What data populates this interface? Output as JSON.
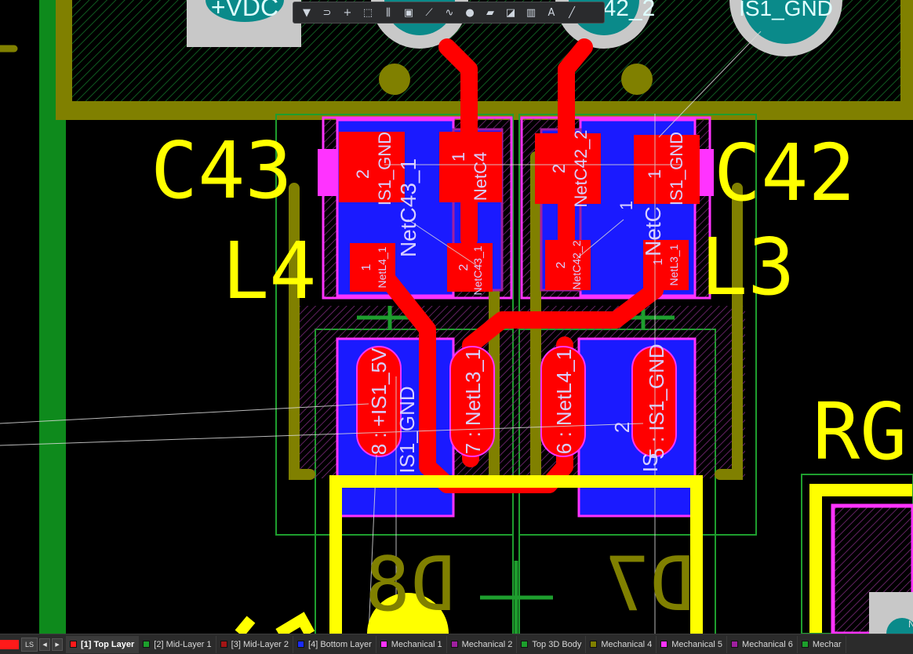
{
  "canvas": {
    "designators": {
      "c43": "C43",
      "c42": "C42",
      "l4": "L4",
      "l3": "L3",
      "rg": "RG",
      "d8": "D8",
      "d7": "D7"
    },
    "pad_labels": {
      "vdc": "+VDC",
      "net42_top": "42_2",
      "is1_gnd_top": "IS1_GND",
      "c43_p2_num": "2",
      "c43_p2_net": "IS1_GND",
      "c43_p1_num": "1",
      "c43_p1_net": "NetC4",
      "c43_body": "NetC43_1",
      "c42_p2_num": "2",
      "c42_p2_net": "NetC42_2",
      "c42_p1_num": "1",
      "c42_p1_net": "IS1_GND",
      "c42_body": "NetC",
      "l4_p1_num": "1",
      "l4_p1_net": "NetL4_1",
      "l4_p2_num": "2",
      "l4_p2_net": "NetC43_1",
      "l3_p2_num": "2",
      "l3_p2_net": "NetC42_2",
      "l3_p1_num": "1",
      "l3_p1_net": "NetL3_1",
      "u_p8": "8 : +IS1_5V",
      "u_p7": "7 : NetL3_1",
      "u_p6": "6 : NetL4_1",
      "u_p5_num": "2",
      "u_p5": "5 : IS1_GND",
      "u_body_left": "IS1_GND",
      "u_body_right": "IS",
      "n_edge": "N"
    }
  },
  "toolbar": {
    "buttons": [
      {
        "name": "filter-tool",
        "icon": "funnel-icon",
        "glyph": "▼"
      },
      {
        "name": "route-tool",
        "icon": "route-icon",
        "glyph": "⊃"
      },
      {
        "name": "cross-probe-tool",
        "icon": "crosshair-icon",
        "glyph": "+"
      },
      {
        "name": "select-rect-tool",
        "icon": "select-rectangle-icon",
        "glyph": "⬚"
      },
      {
        "name": "align-tool",
        "icon": "align-icon",
        "glyph": "⫼"
      },
      {
        "name": "component-tool",
        "icon": "component-icon",
        "glyph": "▣"
      },
      {
        "name": "interactive-route-tool",
        "icon": "interactive-route-icon",
        "glyph": "⟋"
      },
      {
        "name": "diff-pair-tool",
        "icon": "diff-pair-icon",
        "glyph": "∿"
      },
      {
        "name": "via-tool",
        "icon": "via-icon",
        "glyph": "●"
      },
      {
        "name": "fill-tool",
        "icon": "fill-icon",
        "glyph": "▰"
      },
      {
        "name": "polygon-tool",
        "icon": "polygon-icon",
        "glyph": "◪"
      },
      {
        "name": "graph-tool",
        "icon": "graph-icon",
        "glyph": "▥"
      },
      {
        "name": "text-tool",
        "icon": "text-icon",
        "glyph": "A"
      },
      {
        "name": "line-tool",
        "icon": "line-icon",
        "glyph": "╱"
      }
    ]
  },
  "layerbar": {
    "ls_label": "LS",
    "prev": "◀",
    "next": "▶",
    "tabs": [
      {
        "label": "[1] Top Layer",
        "color": "#ff1a1a",
        "active": true
      },
      {
        "label": "[2] Mid-Layer 1",
        "color": "#1c9f2c",
        "active": false
      },
      {
        "label": "[3] Mid-Layer 2",
        "color": "#a31515",
        "active": false
      },
      {
        "label": "[4] Bottom Layer",
        "color": "#1a2cff",
        "active": false
      },
      {
        "label": "Mechanical 1",
        "color": "#ff33ff",
        "active": false
      },
      {
        "label": "Mechanical 2",
        "color": "#a020a0",
        "active": false
      },
      {
        "label": "Top 3D Body",
        "color": "#1c9f2c",
        "active": false
      },
      {
        "label": "Mechanical 4",
        "color": "#808000",
        "active": false
      },
      {
        "label": "Mechanical 5",
        "color": "#ff33ff",
        "active": false
      },
      {
        "label": "Mechanical 6",
        "color": "#a020a0",
        "active": false
      },
      {
        "label": "Mechar",
        "color": "#1c9f2c",
        "active": false
      }
    ]
  },
  "colors": {
    "top_copper": "#ff0000",
    "bottom_layer": "#1a1aff",
    "overlay_yellow": "#ffff00",
    "olive": "#808000",
    "outline_green": "#1e9e2e",
    "magenta": "#ff33ff",
    "pad_teal": "#0a8a8a"
  }
}
